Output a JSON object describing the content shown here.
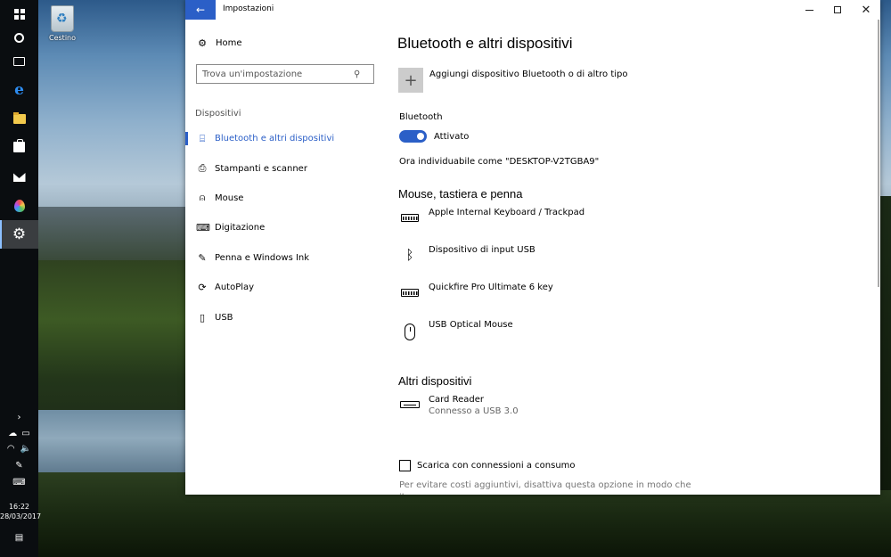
{
  "desktop": {
    "recycle_bin_label": "Cestino"
  },
  "taskbar": {
    "icons": [
      "windows-start-icon",
      "cortana-icon",
      "task-view-icon",
      "edge-icon",
      "file-explorer-icon",
      "store-icon",
      "mail-icon",
      "paint-icon",
      "settings-icon"
    ],
    "clock_time": "16:22",
    "clock_date": "28/03/2017"
  },
  "window": {
    "title": "Impostazioni",
    "accent_color": "#2b5fc7"
  },
  "nav": {
    "home_label": "Home",
    "search_placeholder": "Trova un'impostazione",
    "section_label": "Dispositivi",
    "items": [
      {
        "label": "Bluetooth e altri dispositivi",
        "icon": "devices-icon",
        "selected": true
      },
      {
        "label": "Stampanti e scanner",
        "icon": "printer-icon",
        "selected": false
      },
      {
        "label": "Mouse",
        "icon": "mouse-icon",
        "selected": false
      },
      {
        "label": "Digitazione",
        "icon": "keyboard-icon",
        "selected": false
      },
      {
        "label": "Penna e Windows Ink",
        "icon": "pen-icon",
        "selected": false
      },
      {
        "label": "AutoPlay",
        "icon": "autoplay-icon",
        "selected": false
      },
      {
        "label": "USB",
        "icon": "usb-icon",
        "selected": false
      }
    ]
  },
  "content": {
    "title": "Bluetooth e altri dispositivi",
    "add_device_label": "Aggiungi dispositivo Bluetooth o di altro tipo",
    "bluetooth_label": "Bluetooth",
    "bluetooth_state": "Attivato",
    "discoverable_text": "Ora individuabile come \"DESKTOP-V2TGBA9\"",
    "mouse_section_title": "Mouse, tastiera e penna",
    "mouse_devices": [
      {
        "name": "Apple Internal Keyboard / Trackpad",
        "icon": "keyboard-icon"
      },
      {
        "name": "Dispositivo di input USB",
        "icon": "bluetooth-icon"
      },
      {
        "name": "Quickfire Pro Ultimate 6 key",
        "icon": "keyboard-icon"
      },
      {
        "name": "USB Optical Mouse",
        "icon": "mouse-icon"
      }
    ],
    "other_section_title": "Altri dispositivi",
    "other_devices": [
      {
        "name": "Card Reader",
        "status": "Connesso a USB 3.0",
        "icon": "card-reader-icon"
      }
    ],
    "metered_label": "Scarica con connessioni a consumo",
    "metered_desc": "Per evitare costi aggiuntivi, disattiva questa opzione in modo che il"
  }
}
